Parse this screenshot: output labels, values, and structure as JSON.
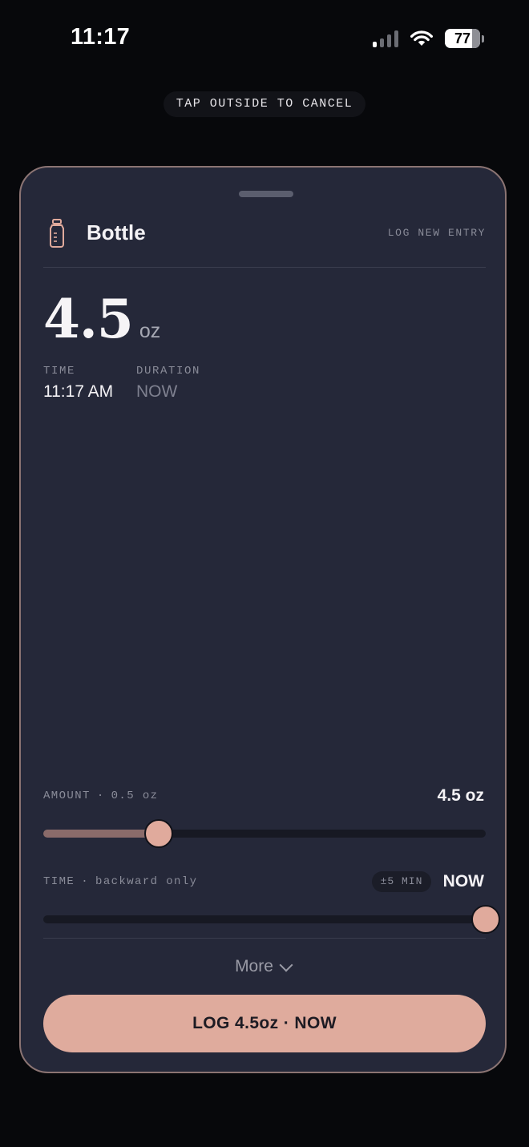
{
  "status_bar": {
    "time": "11:17",
    "battery": "77"
  },
  "hint": "TAP OUTSIDE TO CANCEL",
  "sheet": {
    "title": "Bottle",
    "tag": "LOG NEW ENTRY",
    "amount_value": "4.5",
    "amount_unit": "oz",
    "time_label": "TIME",
    "time_value": "11:17 AM",
    "duration_label": "DURATION",
    "duration_value": "NOW"
  },
  "amount_row": {
    "label": "AMOUNT",
    "step": "0.5 oz",
    "value": "4.5 oz",
    "slider_fraction": 0.26
  },
  "time_row": {
    "label": "TIME",
    "note": "backward only",
    "step_chip": "±5 MIN",
    "value": "NOW",
    "slider_fraction": 1.0
  },
  "more_label": "More",
  "log_button_label": "LOG 4.5oz · NOW",
  "colors": {
    "accent": "#dfab9d",
    "sheet_bg": "#252839",
    "sheet_border": "#8b7473",
    "page_bg": "#07080b"
  },
  "icons": [
    "signal-icon",
    "wifi-icon",
    "battery-icon",
    "bottle-icon",
    "chevron-down-icon"
  ]
}
